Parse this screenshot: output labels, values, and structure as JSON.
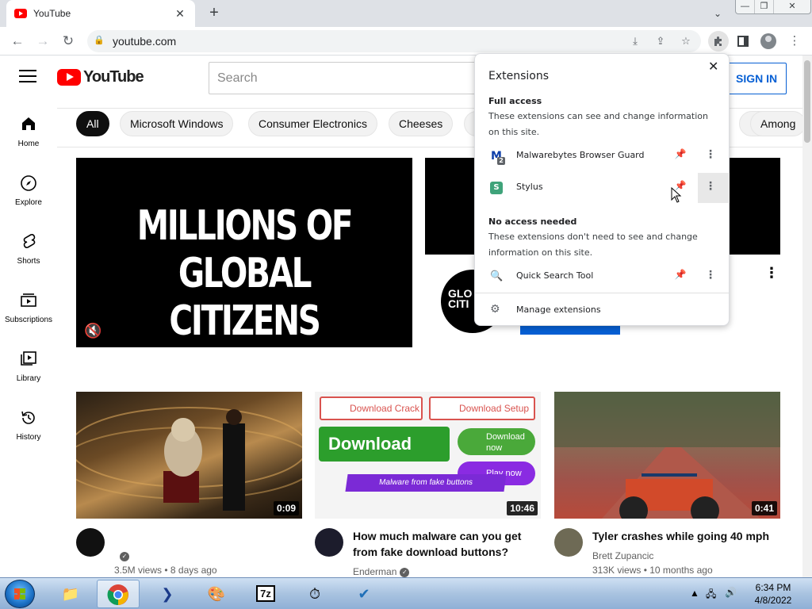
{
  "browser": {
    "tab_title": "YouTube",
    "url": "youtube.com"
  },
  "youtube": {
    "logo_text": "YouTube",
    "search_placeholder": "Search",
    "signin_label": "SIGN IN",
    "chips": [
      "All",
      "Microsoft Windows",
      "Consumer Electronics",
      "Cheeses",
      "Among"
    ],
    "sidebar": [
      {
        "label": "Home",
        "icon": "home-icon"
      },
      {
        "label": "Explore",
        "icon": "compass-icon"
      },
      {
        "label": "Shorts",
        "icon": "shorts-icon"
      },
      {
        "label": "Subscriptions",
        "icon": "subscriptions-icon"
      },
      {
        "label": "Library",
        "icon": "library-icon"
      },
      {
        "label": "History",
        "icon": "history-icon"
      }
    ],
    "featured": {
      "headline_line1": "MILLIONS OF",
      "headline_line2": "GLOBAL CITIZENS",
      "channel_avatar_text_1": "GLO",
      "channel_avatar_text_2": "CITI"
    },
    "videos": [
      {
        "title": "",
        "channel": "",
        "meta": "3.5M views • 8 days ago",
        "duration": "0:09"
      },
      {
        "title": "How much malware can you get from fake download buttons?",
        "channel": "Enderman",
        "meta": "",
        "duration": "10:46",
        "thumb_text": {
          "crack": "Download Crack",
          "setup": "Download Setup",
          "download": "Download",
          "now": "Download now",
          "play": "Play now",
          "band": "Malware from fake buttons"
        }
      },
      {
        "title": "Tyler crashes while going 40 mph",
        "channel": "Brett Zupancic",
        "meta": "313K views • 10 months ago",
        "duration": "0:41"
      }
    ]
  },
  "extensions_popup": {
    "title": "Extensions",
    "full_access": {
      "heading": "Full access",
      "description": "These extensions can see and change information on this site.",
      "items": [
        {
          "name": "Malwarebytes Browser Guard",
          "badge": "2"
        },
        {
          "name": "Stylus"
        }
      ]
    },
    "no_access": {
      "heading": "No access needed",
      "description": "These extensions don't need to see and change information on this site.",
      "items": [
        {
          "name": "Quick Search Tool"
        }
      ]
    },
    "manage_label": "Manage extensions"
  },
  "taskbar": {
    "time": "6:34 PM",
    "date": "4/8/2022"
  }
}
